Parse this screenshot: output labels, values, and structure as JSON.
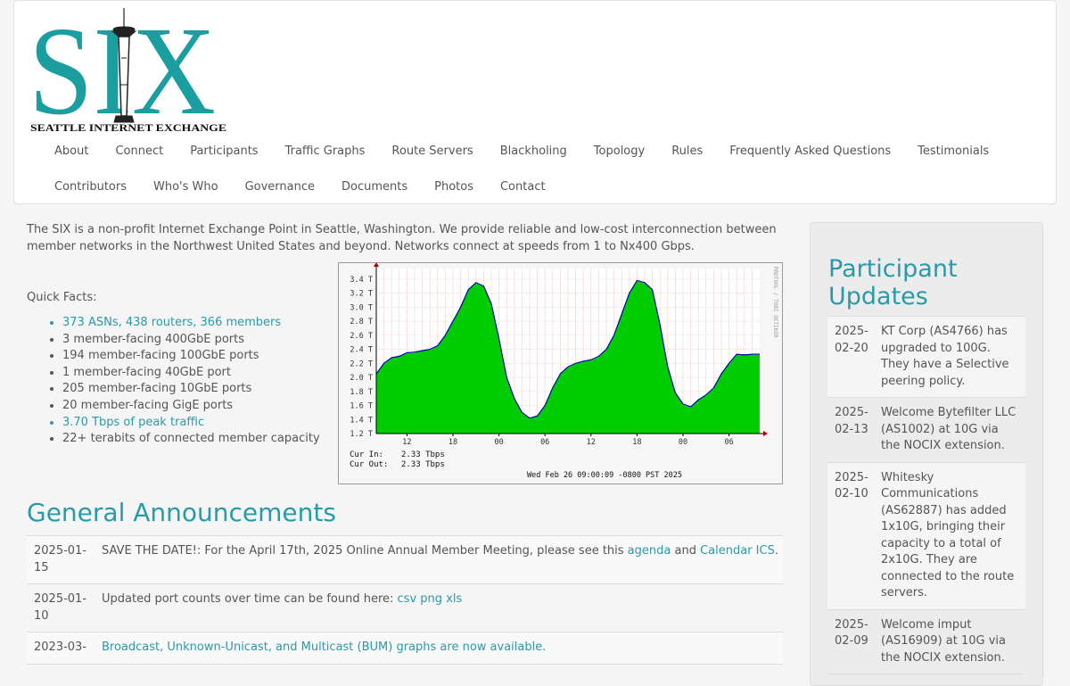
{
  "logo": {
    "letters": "SIX",
    "subtitle": "SEATTLE INTERNET EXCHANGE",
    "icon": "space-needle-icon",
    "color": "#1a9ea0"
  },
  "nav": {
    "row1": [
      "About",
      "Connect",
      "Participants",
      "Traffic Graphs",
      "Route Servers",
      "Blackholing",
      "Topology",
      "Rules",
      "Frequently Asked Questions",
      "Testimonials"
    ],
    "row2": [
      "Contributors",
      "Who's Who",
      "Governance",
      "Documents",
      "Photos",
      "Contact"
    ]
  },
  "intro": "The SIX is a non-profit Internet Exchange Point in Seattle, Washington. We provide reliable and low-cost interconnection between member networks in the Northwest United States and beyond. Networks connect at speeds from 1 to Nx400 Gbps.",
  "quick_facts": {
    "title": "Quick Facts:",
    "items": [
      {
        "text": "373 ASNs, 438 routers, 366 members",
        "link": true
      },
      {
        "text": "3 member-facing 400GbE ports",
        "link": false
      },
      {
        "text": "194 member-facing 100GbE ports",
        "link": false
      },
      {
        "text": "1 member-facing 40GbE port",
        "link": false
      },
      {
        "text": "205 member-facing 10GbE ports",
        "link": false
      },
      {
        "text": "20 member-facing GigE ports",
        "link": false
      },
      {
        "text": "3.70 Tbps of peak traffic",
        "link": true
      },
      {
        "text": "22+ terabits of connected member capacity",
        "link": false
      }
    ]
  },
  "chart_data": {
    "type": "area",
    "y_ticks": [
      "1.2 T",
      "1.4 T",
      "1.6 T",
      "1.8 T",
      "2.0 T",
      "2.2 T",
      "2.4 T",
      "2.6 T",
      "2.8 T",
      "3.0 T",
      "3.2 T",
      "3.4 T"
    ],
    "ylim": [
      1.2,
      3.5
    ],
    "x_ticks": [
      "12",
      "18",
      "00",
      "06",
      "12",
      "18",
      "00",
      "06"
    ],
    "side_label": "RRDTOOL / TOBI OETIKER",
    "cur_in_label": "Cur In:",
    "cur_in": "2.33 Tbps",
    "cur_out_label": "Cur Out:",
    "cur_out": "2.33 Tbps",
    "timestamp": "Wed Feb 26 09:00:09 -0800 PST 2025",
    "fill_color": "#00cc00",
    "line_color": "#0000aa",
    "x_hours": [
      0,
      1,
      2,
      3,
      4,
      5,
      6,
      7,
      8,
      9,
      10,
      11,
      12,
      13,
      14,
      15,
      16,
      17,
      18,
      19,
      20,
      21,
      22,
      23,
      24,
      25,
      26,
      27,
      28,
      29,
      30,
      31,
      32,
      33,
      34,
      35,
      36,
      37,
      38,
      39,
      40,
      41,
      42,
      43,
      44,
      45,
      46,
      47,
      48,
      49,
      50
    ],
    "values": [
      2.05,
      2.2,
      2.28,
      2.3,
      2.35,
      2.36,
      2.38,
      2.4,
      2.45,
      2.6,
      2.8,
      3.0,
      3.25,
      3.35,
      3.3,
      3.05,
      2.55,
      2.0,
      1.7,
      1.5,
      1.42,
      1.45,
      1.6,
      1.85,
      2.05,
      2.15,
      2.2,
      2.23,
      2.25,
      2.3,
      2.4,
      2.6,
      2.9,
      3.2,
      3.38,
      3.35,
      3.25,
      2.75,
      2.15,
      1.78,
      1.62,
      1.58,
      1.68,
      1.75,
      1.85,
      2.05,
      2.2,
      2.33,
      2.32,
      2.33,
      2.33
    ]
  },
  "announcements": {
    "title": "General Announcements",
    "rows": [
      {
        "date": "2025-01-15",
        "parts": [
          {
            "t": "SAVE THE DATE!: For the April 17th, 2025 Online Annual Member Meeting, please see this "
          },
          {
            "t": "agenda",
            "link": true
          },
          {
            "t": " and "
          },
          {
            "t": "Calendar ICS",
            "link": true
          },
          {
            "t": "."
          }
        ]
      },
      {
        "date": "2025-01-10",
        "parts": [
          {
            "t": "Updated port counts over time can be found here: "
          },
          {
            "t": "csv",
            "link": true
          },
          {
            "t": " "
          },
          {
            "t": "png",
            "link": true
          },
          {
            "t": " "
          },
          {
            "t": "xls",
            "link": true
          }
        ]
      },
      {
        "date": "2023-03-",
        "parts": [
          {
            "t": "Broadcast, Unknown-Unicast, and Multicast (BUM) graphs are now available.",
            "link": true
          }
        ]
      }
    ]
  },
  "updates": {
    "title": "Participant Updates",
    "rows": [
      {
        "date": "2025-02-20",
        "text": "KT Corp (AS4766) has upgraded to 100G. They have a Selective peering policy."
      },
      {
        "date": "2025-02-13",
        "text": "Welcome Bytefilter LLC (AS1002) at 10G via the NOCIX extension."
      },
      {
        "date": "2025-02-10",
        "text": "Whitesky Communications (AS62887) has added 1x10G, bringing their capacity to a total of 2x10G. They are connected to the route servers."
      },
      {
        "date": "2025-02-09",
        "text": "Welcome imput (AS16909) at 10G via the NOCIX extension."
      }
    ]
  }
}
